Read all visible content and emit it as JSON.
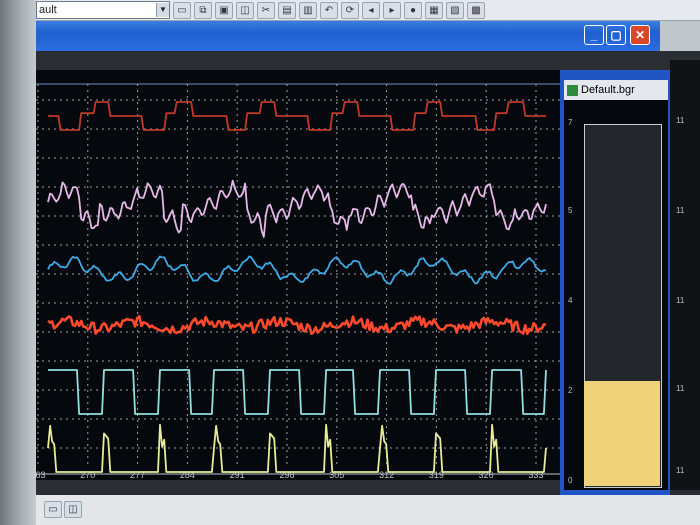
{
  "toolbar": {
    "layout_combo": "ault"
  },
  "window_buttons": {
    "minimize": "_",
    "restore": "▢",
    "close": "✕"
  },
  "bar_panel": {
    "title": "Default.bgr",
    "scale_labels": [
      "7",
      "5",
      "4",
      "2",
      "0"
    ],
    "bar_level": 0.29
  },
  "right_panel": {
    "scale_labels": [
      "11",
      "11",
      "11",
      "11",
      "11"
    ]
  },
  "chart_data": {
    "type": "line",
    "x_ticks": [
      "263",
      "270",
      "277",
      "284",
      "291",
      "298",
      "305",
      "312",
      "319",
      "326",
      "333"
    ],
    "xlim": [
      263,
      333
    ],
    "grid": true,
    "series": [
      {
        "color": "#c0392b"
      },
      {
        "color": "#e6b8e8"
      },
      {
        "color": "#3fa9e6"
      },
      {
        "color": "#ff4a2e"
      },
      {
        "color": "#8fe0e0"
      },
      {
        "color": "#e8ec96"
      }
    ]
  },
  "colors": {
    "accent": "#1f5fd0",
    "plot_bg": "#05080c",
    "grid": "#9aa0a6",
    "bar": "#efd27a"
  }
}
